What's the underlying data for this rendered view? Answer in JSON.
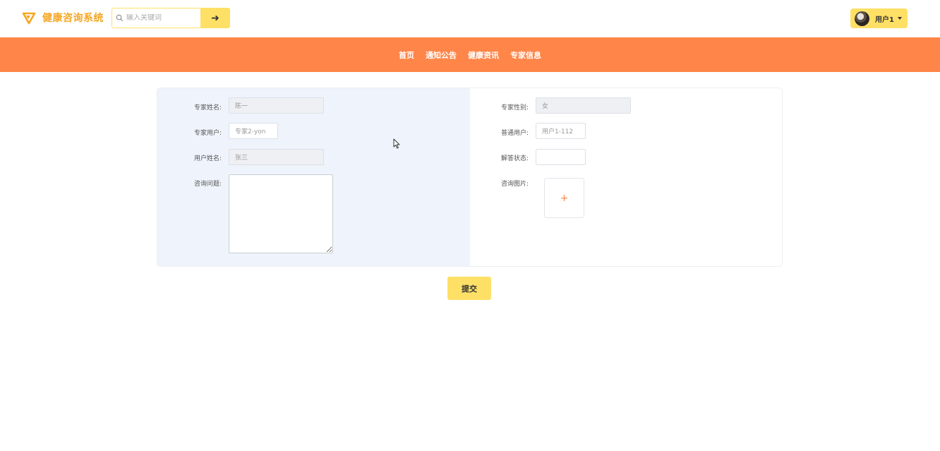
{
  "header": {
    "logo_text": "健康咨询系统",
    "search": {
      "placeholder": "输入关键词",
      "button_label": "➜"
    },
    "user": {
      "name": "用户1"
    }
  },
  "nav": {
    "items": [
      {
        "label": "首页"
      },
      {
        "label": "通知公告"
      },
      {
        "label": "健康资讯"
      },
      {
        "label": "专家信息"
      }
    ]
  },
  "form": {
    "expert_name": {
      "label": "专家姓名:",
      "value": "陈一"
    },
    "expert_gender": {
      "label": "专家性别:",
      "value": "女"
    },
    "expert_user": {
      "label": "专家用户:",
      "value": "专家2-yon"
    },
    "normal_user": {
      "label": "普通用户:",
      "value": "用户1-112"
    },
    "user_name": {
      "label": "用户姓名:",
      "value": "张三"
    },
    "answer_status": {
      "label": "解答状态:",
      "value": ""
    },
    "question": {
      "label": "咨询问题:",
      "value": ""
    },
    "image": {
      "label": "咨询图片:",
      "upload_symbol": "+"
    },
    "submit_label": "提交"
  },
  "colors": {
    "brand": "#f5a623",
    "nav_bg": "#ff8548",
    "button_bg": "#ffe066",
    "panel_left_bg": "#eff4fc"
  }
}
